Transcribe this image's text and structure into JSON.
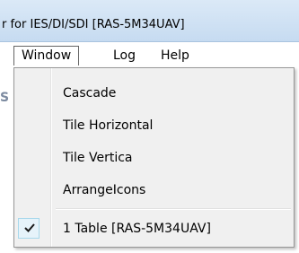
{
  "window": {
    "title": "r for IES/DI/SDI [RAS-5M34UAV]"
  },
  "menu_bar": {
    "items": [
      {
        "label": "Window",
        "active": true
      },
      {
        "label": "Log",
        "active": false
      },
      {
        "label": "Help",
        "active": false
      }
    ]
  },
  "background": {
    "partial_char": "S"
  },
  "window_menu": {
    "items": [
      {
        "label": "Cascade"
      },
      {
        "label": "Tile Horizontal"
      },
      {
        "label": "Tile Vertica"
      },
      {
        "label": "ArrangeIcons"
      }
    ],
    "open_windows": [
      {
        "label": "1 Table [RAS-5M34UAV]",
        "checked": true,
        "icon": "checkmark-icon"
      }
    ]
  },
  "colors": {
    "title_bar": "#c6dbf1",
    "menu_background": "#f0f0f0",
    "check_highlight": "#e6f3fa"
  }
}
